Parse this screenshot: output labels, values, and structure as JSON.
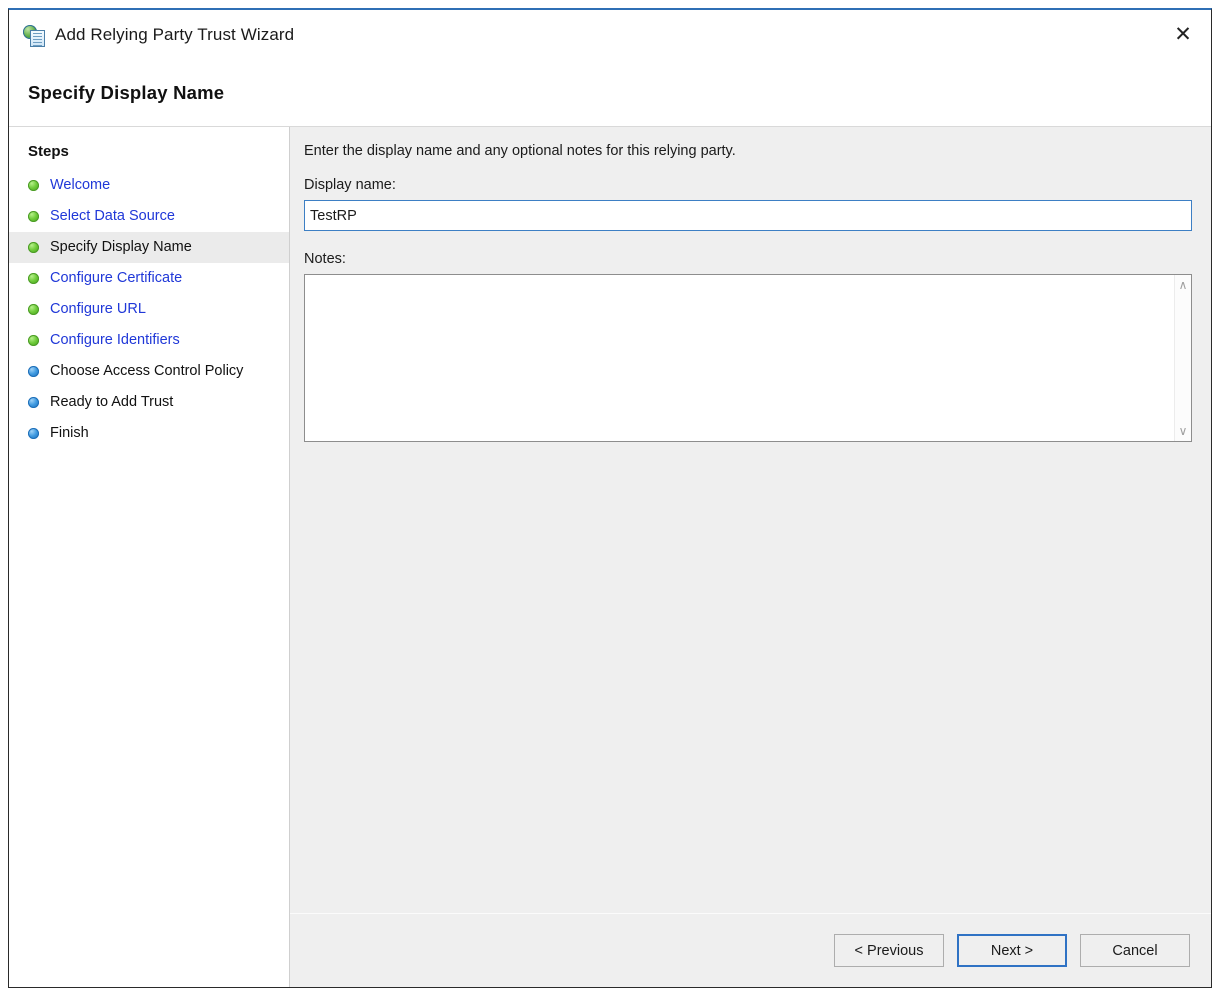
{
  "window": {
    "title": "Add Relying Party Trust Wizard",
    "icon": "relying-party-wizard-icon",
    "close_label": "✕",
    "accent_color": "#2f6fb5"
  },
  "page": {
    "title": "Specify Display Name"
  },
  "sidebar": {
    "heading": "Steps",
    "items": [
      {
        "label": "Welcome",
        "state": "done"
      },
      {
        "label": "Select Data Source",
        "state": "done"
      },
      {
        "label": "Specify Display Name",
        "state": "current"
      },
      {
        "label": "Configure Certificate",
        "state": "done"
      },
      {
        "label": "Configure URL",
        "state": "done"
      },
      {
        "label": "Configure Identifiers",
        "state": "done"
      },
      {
        "label": "Choose Access Control Policy",
        "state": "pending"
      },
      {
        "label": "Ready to Add Trust",
        "state": "pending"
      },
      {
        "label": "Finish",
        "state": "pending"
      }
    ]
  },
  "main": {
    "intro": "Enter the display name and any optional notes for this relying party.",
    "display_name_label": "Display name:",
    "display_name_value": "TestRP",
    "display_name_placeholder": "",
    "notes_label": "Notes:",
    "notes_value": "",
    "notes_placeholder": "",
    "scroll_up_glyph": "∧",
    "scroll_down_glyph": "∨"
  },
  "footer": {
    "previous_label": "< Previous",
    "next_label": "Next >",
    "cancel_label": "Cancel"
  }
}
